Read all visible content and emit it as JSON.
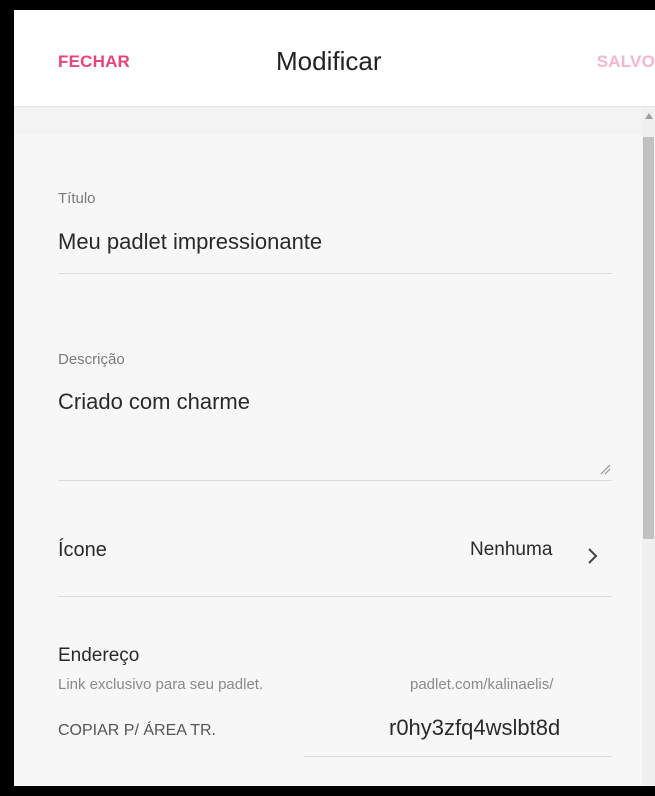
{
  "header": {
    "close_label": "FECHAR",
    "title": "Modificar",
    "saved_label": "SALVO"
  },
  "form": {
    "title": {
      "label": "Título",
      "value": "Meu padlet impressionante"
    },
    "description": {
      "label": "Descrição",
      "value": "Criado com charme"
    },
    "icon": {
      "label": "Ícone",
      "value": "Nenhuma",
      "chevron_icon": "chevron-right-icon"
    },
    "address": {
      "label": "Endereço",
      "hint": "Link exclusivo para seu padlet.",
      "url_prefix": "padlet.com/kalinaelis/",
      "copy_label": "COPIAR P/ ÁREA TR.",
      "slug": "r0hy3zfq4wslbt8d"
    }
  },
  "colors": {
    "accent": "#e8447c",
    "accent_disabled": "#f6b6cb"
  }
}
